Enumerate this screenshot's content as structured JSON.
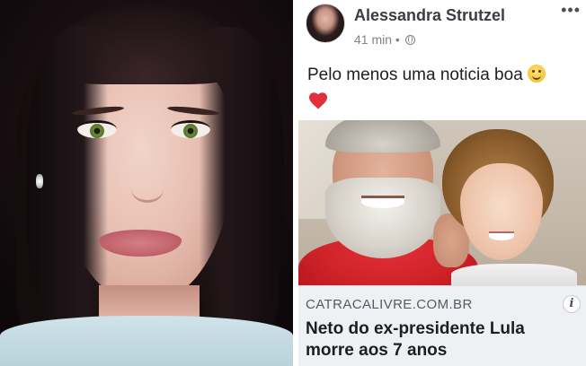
{
  "post": {
    "author": "Alessandra Strutzel",
    "time": "41 min",
    "separator": "•",
    "audience_icon": "globe-icon",
    "more_icon": "more-options-icon",
    "more_symbol": "•••",
    "text": "Pelo menos uma noticia boa",
    "emoji_icons": [
      "smile-icon",
      "heart-icon"
    ],
    "link": {
      "domain": "CATRACALIVRE.COM.BR",
      "title": "Neto do ex-presidente Lula morre aos 7 anos",
      "info_icon": "info-icon",
      "info_symbol": "i"
    }
  },
  "colors": {
    "author": "#3b3d44",
    "meta": "#7f838a",
    "link_bg": "#eef0f3",
    "heart": "#e0303c",
    "shirt_red": "#cd2128"
  }
}
